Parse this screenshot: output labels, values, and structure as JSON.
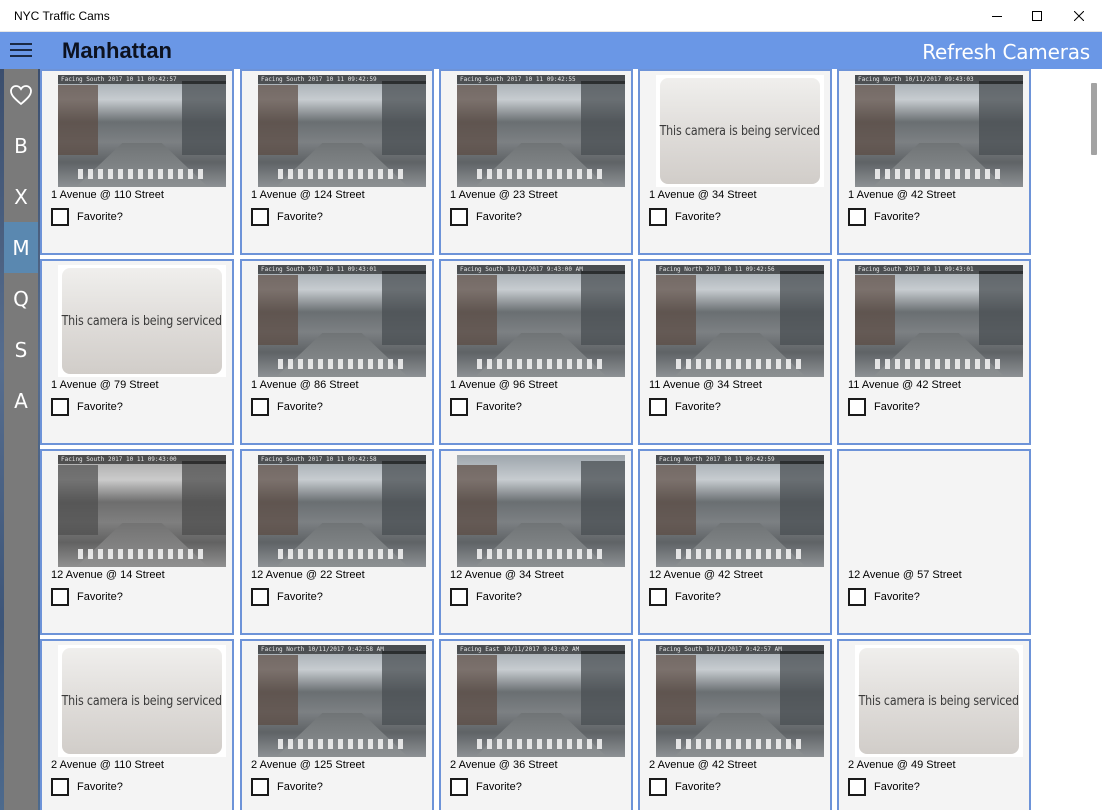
{
  "window": {
    "title": "NYC Traffic Cams"
  },
  "header": {
    "title": "Manhattan",
    "refresh_label": "Refresh Cameras"
  },
  "rail": {
    "items": [
      {
        "label": "",
        "icon": "heart-icon",
        "active": false
      },
      {
        "label": "B",
        "active": false
      },
      {
        "label": "X",
        "active": false
      },
      {
        "label": "M",
        "active": true
      },
      {
        "label": "Q",
        "active": false
      },
      {
        "label": "S",
        "active": false
      },
      {
        "label": "A",
        "active": false
      }
    ]
  },
  "favorite_label": "Favorite?",
  "serviced_text": "This camera is being serviced",
  "cameras": [
    {
      "name": "1 Avenue @ 110 Street",
      "image": "photo",
      "stamp": "Facing South   2017 10 11 09:42:57"
    },
    {
      "name": "1 Avenue @ 124 Street",
      "image": "photo",
      "stamp": "Facing South   2017 10 11 09:42:59"
    },
    {
      "name": "1 Avenue @ 23 Street",
      "image": "photo",
      "stamp": "Facing South   2017 10 11 09:42:55"
    },
    {
      "name": "1 Avenue @ 34 Street",
      "image": "serviced",
      "stamp": ""
    },
    {
      "name": "1 Avenue @ 42 Street",
      "image": "photo",
      "stamp": "Facing North   10/11/2017 09:43:03"
    },
    {
      "name": "1 Avenue @ 79 Street",
      "image": "serviced",
      "stamp": ""
    },
    {
      "name": "1 Avenue @ 86 Street",
      "image": "photo",
      "stamp": "Facing South   2017 10 11 09:43:01"
    },
    {
      "name": "1 Avenue @ 96 Street",
      "image": "photo",
      "stamp": "Facing South   10/11/2017 9:43:00 AM"
    },
    {
      "name": "11 Avenue @ 34 Street",
      "image": "photo",
      "stamp": "Facing North   2017 10 11 09:42:56"
    },
    {
      "name": "11 Avenue @ 42 Street",
      "image": "photo",
      "stamp": "Facing South   2017 10 11 09:43:01"
    },
    {
      "name": "12 Avenue @ 14 Street",
      "image": "photo-gray",
      "stamp": "Facing South   2017 10 11 09:43:00"
    },
    {
      "name": "12 Avenue @ 22 Street",
      "image": "photo",
      "stamp": "Facing South   2017 10 11 09:42:58"
    },
    {
      "name": "12 Avenue @ 34 Street",
      "image": "photo",
      "stamp": ""
    },
    {
      "name": "12 Avenue @ 42 Street",
      "image": "photo",
      "stamp": "Facing North   2017 10 11 09:42:59"
    },
    {
      "name": "12 Avenue @ 57 Street",
      "image": "empty",
      "stamp": ""
    },
    {
      "name": "2 Avenue @ 110 Street",
      "image": "serviced",
      "stamp": ""
    },
    {
      "name": "2 Avenue @ 125 Street",
      "image": "photo",
      "stamp": "Facing North   10/11/2017 9:42:58 AM"
    },
    {
      "name": "2 Avenue @ 36 Street",
      "image": "photo",
      "stamp": "Facing East   10/11/2017 9:43:02 AM"
    },
    {
      "name": "2 Avenue @ 42 Street",
      "image": "photo",
      "stamp": "Facing South   10/11/2017 9:42:57 AM"
    },
    {
      "name": "2 Avenue @ 49 Street",
      "image": "serviced",
      "stamp": ""
    }
  ]
}
